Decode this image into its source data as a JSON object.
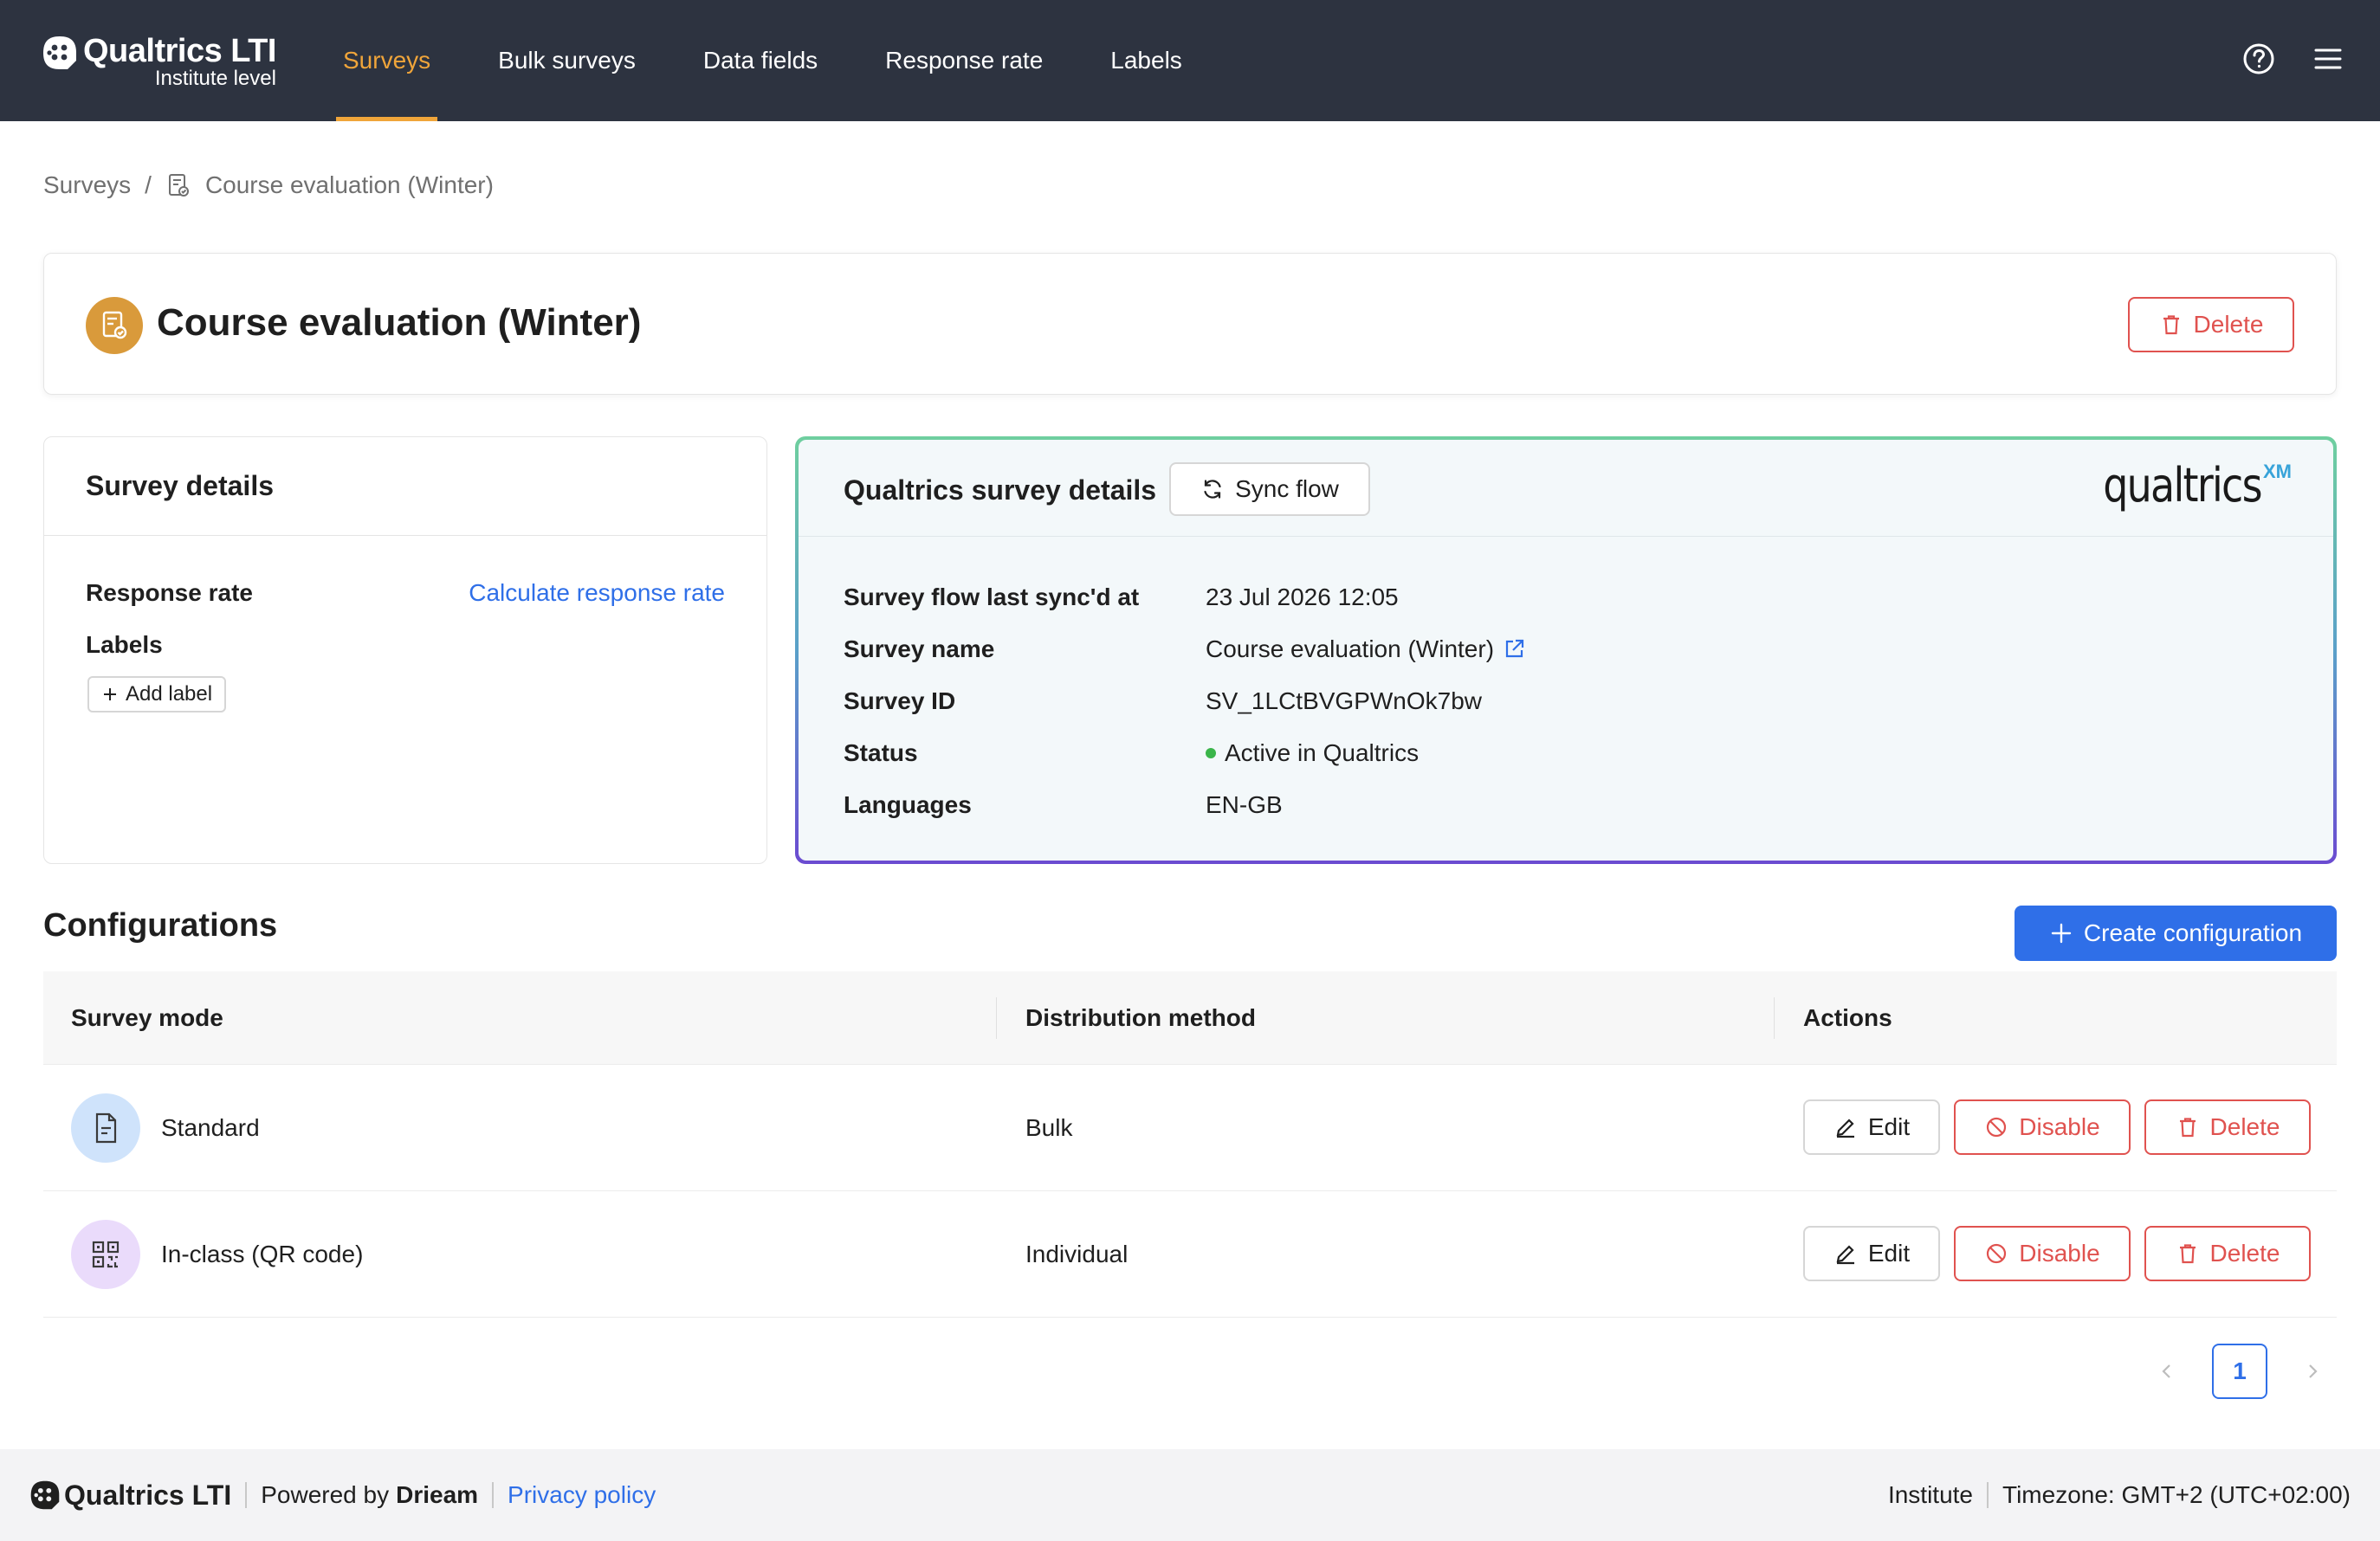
{
  "app": {
    "brand_name": "Qualtrics LTI",
    "brand_sub": "Institute level"
  },
  "nav": {
    "items": [
      {
        "label": "Surveys",
        "active": true
      },
      {
        "label": "Bulk surveys",
        "active": false
      },
      {
        "label": "Data fields",
        "active": false
      },
      {
        "label": "Response rate",
        "active": false
      },
      {
        "label": "Labels",
        "active": false
      }
    ],
    "icons": [
      "help-circle-icon",
      "hamburger-menu-icon"
    ]
  },
  "breadcrumb": {
    "root": "Surveys",
    "separator": "/",
    "current": "Course evaluation (Winter)"
  },
  "header": {
    "title": "Course evaluation (Winter)",
    "delete_label": "Delete"
  },
  "survey_details": {
    "title": "Survey details",
    "response_rate_label": "Response rate",
    "response_rate_action": "Calculate response rate",
    "labels_label": "Labels",
    "add_label": "Add label"
  },
  "qualtrics_details": {
    "title": "Qualtrics survey details",
    "sync_label": "Sync flow",
    "logo_text": "qualtrics",
    "logo_superscript": "XM",
    "rows": [
      {
        "key": "Survey flow last sync'd at",
        "value": "23 Jul 2026 12:05"
      },
      {
        "key": "Survey name",
        "value": "Course evaluation (Winter)"
      },
      {
        "key": "Survey ID",
        "value": "SV_1LCtBVGPWnOk7bw"
      },
      {
        "key": "Status",
        "value": "Active in Qualtrics"
      },
      {
        "key": "Languages",
        "value": "EN-GB"
      }
    ]
  },
  "configurations": {
    "title": "Configurations",
    "create_label": "Create configuration",
    "columns": [
      "Survey mode",
      "Distribution method",
      "Actions"
    ],
    "rows": [
      {
        "mode": "Standard",
        "method": "Bulk",
        "icon": "document-icon"
      },
      {
        "mode": "In-class (QR code)",
        "method": "Individual",
        "icon": "qr-code-icon"
      }
    ],
    "actions": {
      "edit": "Edit",
      "disable": "Disable",
      "delete": "Delete"
    }
  },
  "pagination": {
    "current": "1"
  },
  "footer": {
    "brand": "Qualtrics LTI",
    "powered_prefix": "Powered by",
    "powered_name": "Drieam",
    "privacy": "Privacy policy",
    "scope": "Institute",
    "timezone": "Timezone: GMT+2 (UTC+02:00)"
  },
  "colors": {
    "nav_bg": "#2d3340",
    "accent": "#f0a53a",
    "primary": "#2f6fe8",
    "danger": "#e0524f",
    "status_active": "#3ab54a"
  }
}
